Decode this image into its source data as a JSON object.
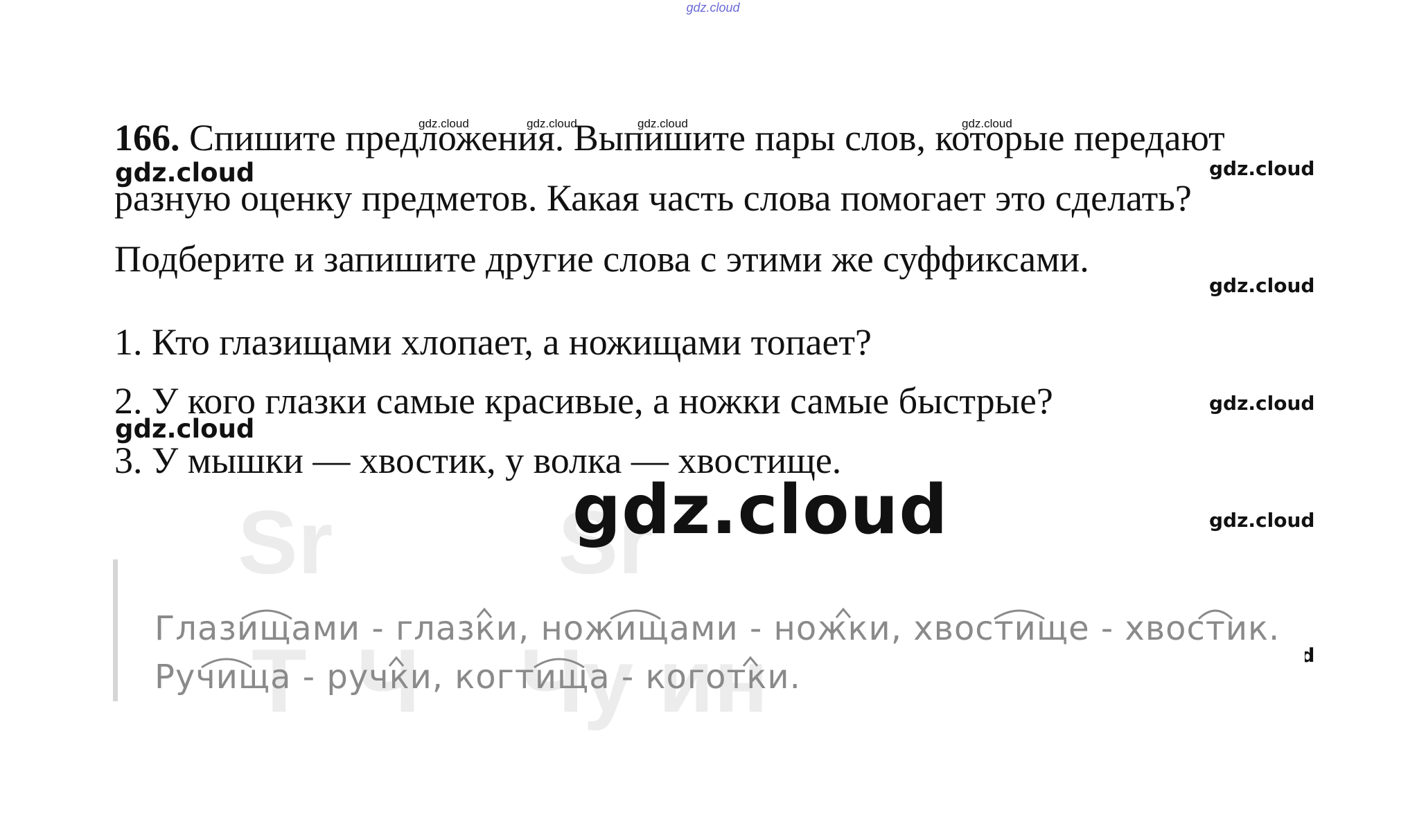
{
  "watermark": "gdz.cloud",
  "exercise": {
    "number": "166.",
    "line1": "Спишите предложения. Выпишите пары слов, которые передают",
    "line2": "разную оценку предметов. Какая часть слова помогает это сделать?",
    "line3": "Подберите и запишите другие слова с этими же суффиксами."
  },
  "sentences": [
    "1. Кто глазищами хлопает, а ножищами топает?",
    "2. У кого глазки самые красивые, а ножки самые быстрые?",
    "3. У мышки — хвостик, у волка — хвостище."
  ],
  "answer": {
    "line1": "Глазищами - глазки, ножищами - ножки, хвостище - хвостик.",
    "line2": "Ручища - ручки, когтища - коготки."
  }
}
